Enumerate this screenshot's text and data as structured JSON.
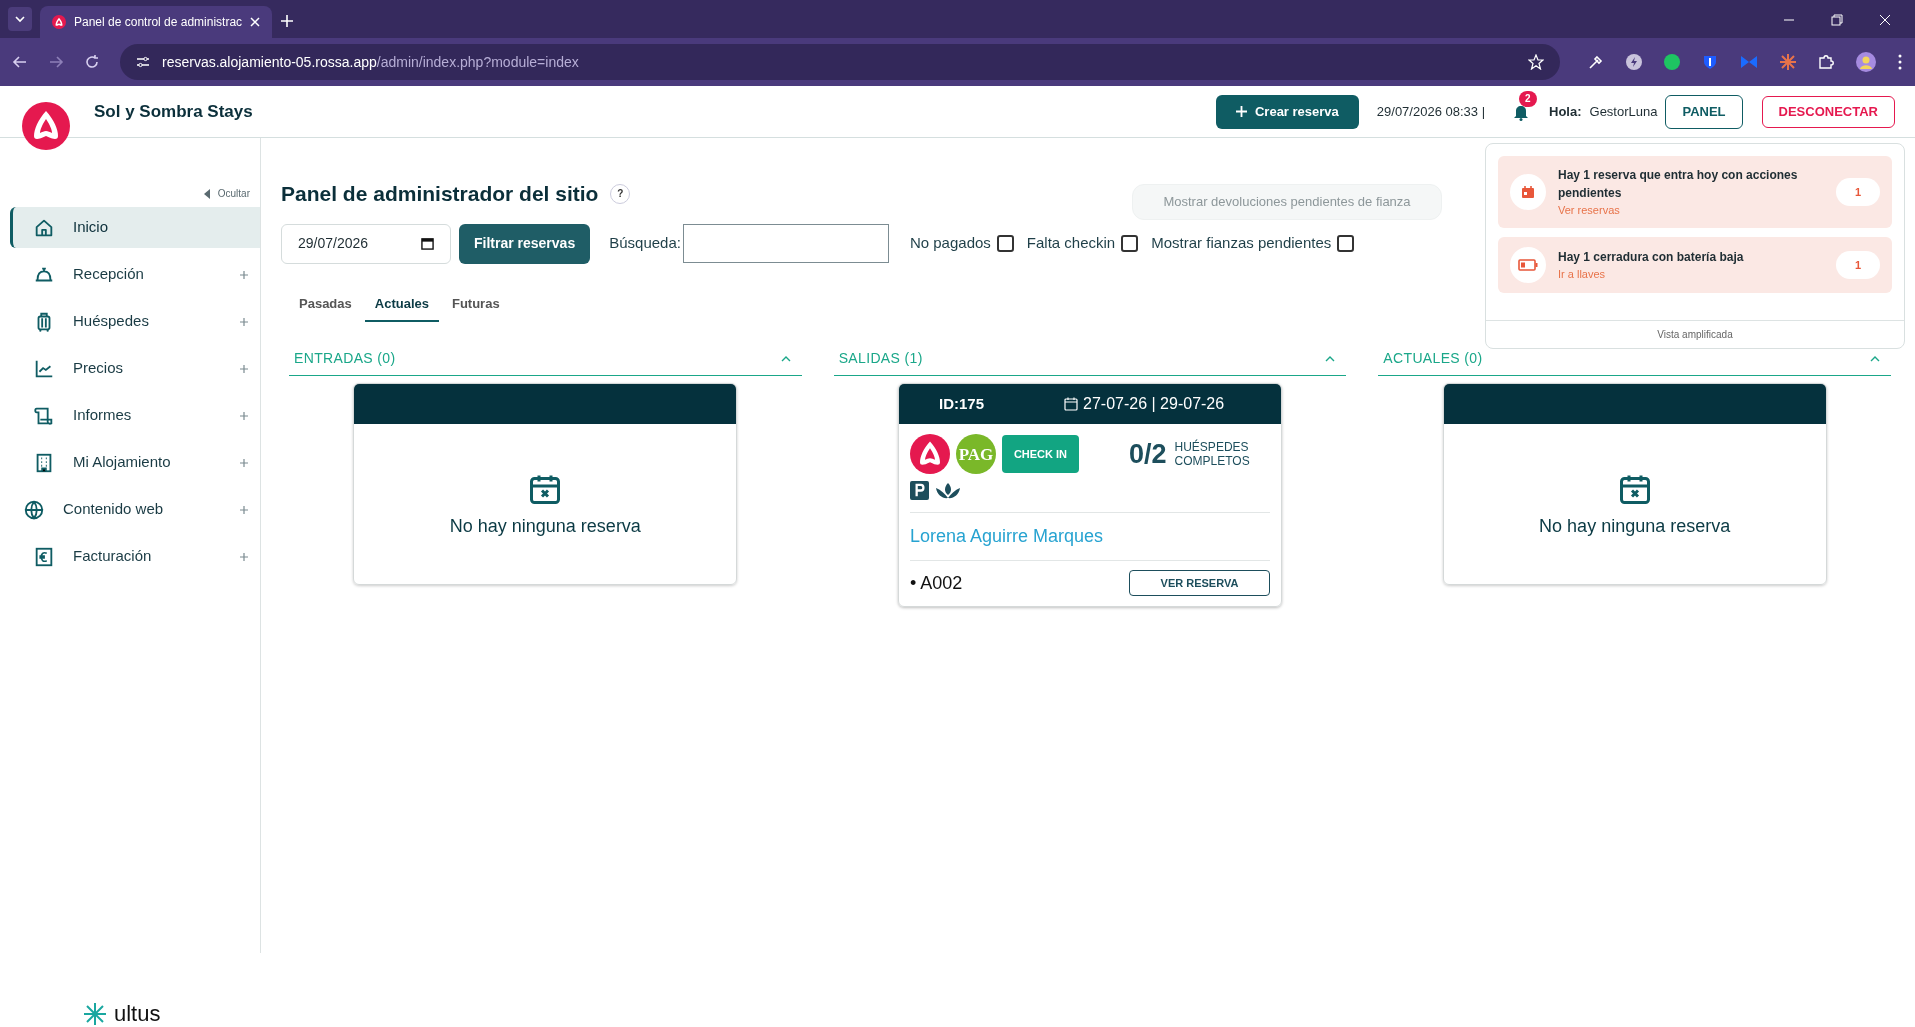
{
  "browser": {
    "tab_title": "Panel de control de administrac",
    "url_host": "reservas.alojamiento-05.rossa.app",
    "url_path": "/admin/index.php?module=index"
  },
  "header": {
    "brand": "Sol y Sombra Stays",
    "create_button": "Crear reserva",
    "datetime": "29/07/2026 08:33 |",
    "notification_count": "2",
    "greeting_label": "Hola:",
    "user": "GestorLuna",
    "panel_button": "PANEL",
    "logout_button": "DESCONECTAR"
  },
  "sidebar": {
    "hide_label": "Ocultar",
    "items": [
      {
        "label": "Inicio",
        "kind": "home",
        "selected": true,
        "expandable": false
      },
      {
        "label": "Recepción",
        "kind": "bell",
        "selected": false,
        "expandable": true
      },
      {
        "label": "Huéspedes",
        "kind": "luggage",
        "selected": false,
        "expandable": true
      },
      {
        "label": "Precios",
        "kind": "chart",
        "selected": false,
        "expandable": true
      },
      {
        "label": "Informes",
        "kind": "scroll",
        "selected": false,
        "expandable": true
      },
      {
        "label": "Mi Alojamiento",
        "kind": "building",
        "selected": false,
        "expandable": true
      },
      {
        "label": "Contenido web",
        "kind": "globe",
        "selected": false,
        "expandable": true
      },
      {
        "label": "Facturación",
        "kind": "euro",
        "selected": false,
        "expandable": true
      }
    ]
  },
  "page": {
    "title": "Panel de administrador del sitio",
    "help": "?",
    "date": "29/07/2026",
    "filter_button": "Filtrar reservas",
    "search_label": "Búsqueda:",
    "checkboxes": [
      {
        "label": "No pagados",
        "checked": false
      },
      {
        "label": "Falta checkin",
        "checked": false
      },
      {
        "label": "Mostrar fianzas pendientes",
        "checked": false
      }
    ],
    "tooltip": "Mostrar devoluciones pendientes de fianza",
    "tabs": [
      {
        "label": "Pasadas",
        "selected": false
      },
      {
        "label": "Actuales",
        "selected": true
      },
      {
        "label": "Futuras",
        "selected": false
      }
    ],
    "columns": [
      {
        "title": "ENTRADAS (0)",
        "expanded": true,
        "empty_text": "No hay ninguna reserva"
      },
      {
        "title": "SALIDAS (1)",
        "expanded": true,
        "cards": [
          {
            "id": "ID:175",
            "dates": "27-07-26 | 29-07-26",
            "payment_badge": "PAG",
            "status_button": "CHECK IN",
            "guests_count": "0/2",
            "guests_label_1": "HUÉSPEDES",
            "guests_label_2": "COMPLETOS",
            "guest_name": "Lorena Aguirre Marques",
            "unit": "• A002",
            "view_button": "VER RESERVA"
          }
        ]
      },
      {
        "title": "ACTUALES (0)",
        "expanded": true,
        "empty_text": "No hay ninguna reserva"
      }
    ]
  },
  "notifications": {
    "items": [
      {
        "kind": "calendar",
        "title": "Hay 1 reserva que entra hoy con acciones pendientes",
        "link": "Ver reservas",
        "count": "1"
      },
      {
        "kind": "battery",
        "title": "Hay 1 cerradura con batería baja",
        "link": "Ir a llaves",
        "count": "1"
      }
    ],
    "footer": "Vista amplificada"
  },
  "footer": {
    "logo_text": "ultus"
  }
}
